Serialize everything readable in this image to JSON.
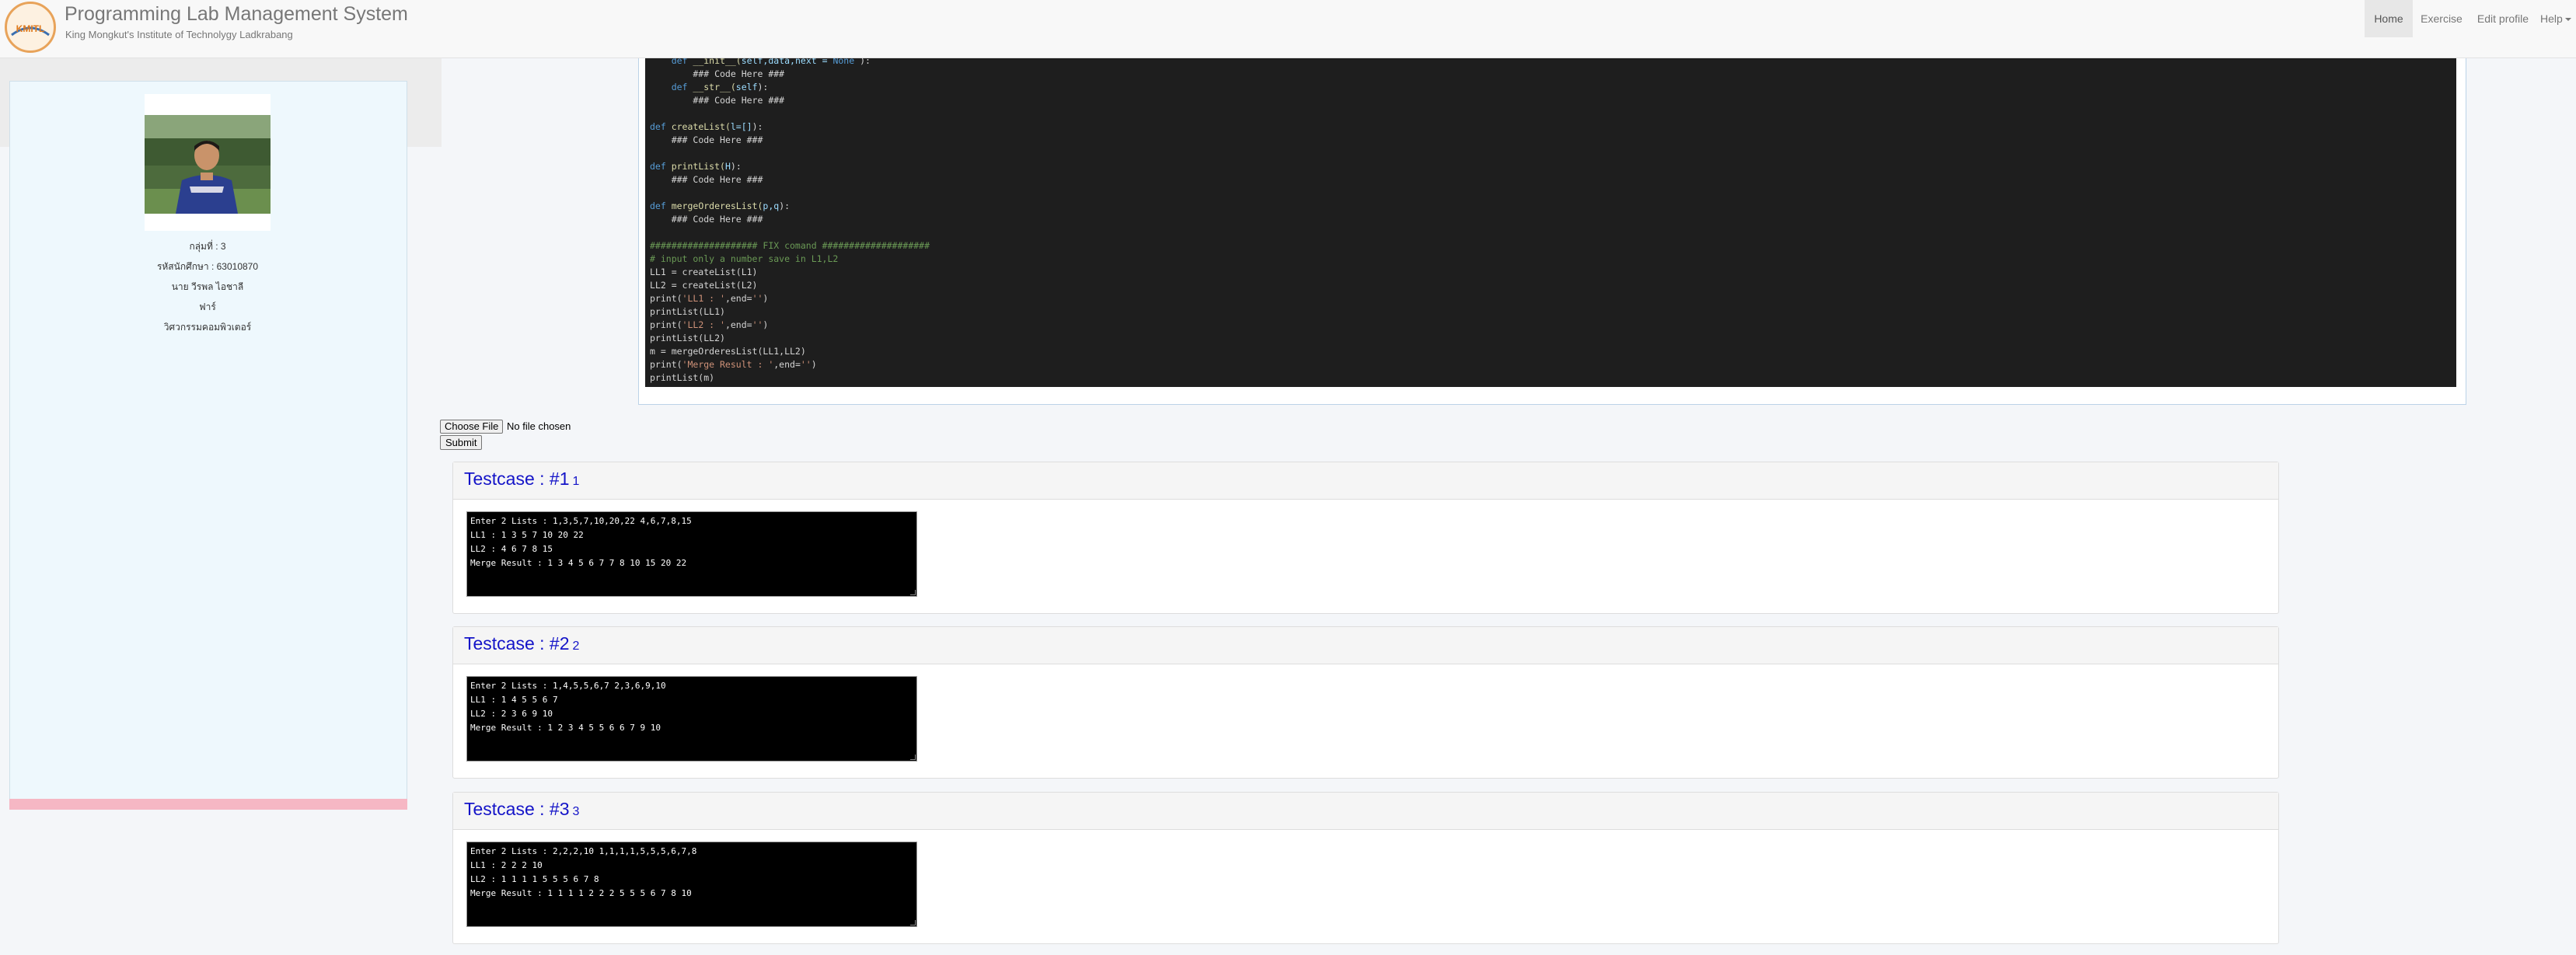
{
  "app": {
    "title": "Programming Lab Management System",
    "subtitle": "King Mongkut's Institute of Technolygy Ladkrabang",
    "logo_text": "KMITL"
  },
  "nav": {
    "home": "Home",
    "exercise": "Exercise",
    "edit_profile": "Edit profile",
    "help": "Help"
  },
  "profile": {
    "group": "กลุ่มที่ : 3",
    "student_id": "รหัสนักศึกษา : 63010870",
    "name": "นาย วีรพล ไอชาลี",
    "nickname": "ฟาร์",
    "faculty": "วิศวกรรมคอมพิวเตอร์"
  },
  "code_lines": [
    {
      "indent": "    ",
      "tokens": [
        {
          "t": "def",
          "c": "kw"
        },
        {
          "t": " __init__(",
          "c": "fn"
        },
        {
          "t": "self,data,next = ",
          "c": "var"
        },
        {
          "t": "None",
          "c": "kw"
        },
        {
          "t": " ):",
          "c": ""
        }
      ]
    },
    {
      "indent": "        ",
      "tokens": [
        {
          "t": "### Code Here ###",
          "c": ""
        }
      ]
    },
    {
      "indent": "    ",
      "tokens": [
        {
          "t": "def",
          "c": "kw"
        },
        {
          "t": " __str__(",
          "c": "fn"
        },
        {
          "t": "self",
          "c": "var"
        },
        {
          "t": "):",
          "c": ""
        }
      ]
    },
    {
      "indent": "        ",
      "tokens": [
        {
          "t": "### Code Here ###",
          "c": ""
        }
      ]
    },
    {
      "indent": "",
      "tokens": []
    },
    {
      "indent": "",
      "tokens": [
        {
          "t": "def",
          "c": "kw"
        },
        {
          "t": " createList(",
          "c": "fn"
        },
        {
          "t": "l=[]",
          "c": "var"
        },
        {
          "t": "):",
          "c": ""
        }
      ]
    },
    {
      "indent": "    ",
      "tokens": [
        {
          "t": "### Code Here ###",
          "c": ""
        }
      ]
    },
    {
      "indent": "",
      "tokens": []
    },
    {
      "indent": "",
      "tokens": [
        {
          "t": "def",
          "c": "kw"
        },
        {
          "t": " printList(",
          "c": "fn"
        },
        {
          "t": "H",
          "c": "var"
        },
        {
          "t": "):",
          "c": ""
        }
      ]
    },
    {
      "indent": "    ",
      "tokens": [
        {
          "t": "### Code Here ###",
          "c": ""
        }
      ]
    },
    {
      "indent": "",
      "tokens": []
    },
    {
      "indent": "",
      "tokens": [
        {
          "t": "def",
          "c": "kw"
        },
        {
          "t": " mergeOrderesList(",
          "c": "fn"
        },
        {
          "t": "p,q",
          "c": "var"
        },
        {
          "t": "):",
          "c": ""
        }
      ]
    },
    {
      "indent": "    ",
      "tokens": [
        {
          "t": "### Code Here ###",
          "c": ""
        }
      ]
    },
    {
      "indent": "",
      "tokens": []
    },
    {
      "indent": "",
      "tokens": [
        {
          "t": "#################### FIX comand ####################",
          "c": "cm"
        }
      ]
    },
    {
      "indent": "",
      "tokens": [
        {
          "t": "# input only a number save in L1,L2",
          "c": "cm"
        }
      ]
    },
    {
      "indent": "",
      "tokens": [
        {
          "t": "LL1 = createList(L1)",
          "c": ""
        }
      ]
    },
    {
      "indent": "",
      "tokens": [
        {
          "t": "LL2 = createList(L2)",
          "c": ""
        }
      ]
    },
    {
      "indent": "",
      "tokens": [
        {
          "t": "print(",
          "c": ""
        },
        {
          "t": "'LL1 : '",
          "c": "str"
        },
        {
          "t": ",end=",
          "c": ""
        },
        {
          "t": "''",
          "c": "str"
        },
        {
          "t": ")",
          "c": ""
        }
      ]
    },
    {
      "indent": "",
      "tokens": [
        {
          "t": "printList(LL1)",
          "c": ""
        }
      ]
    },
    {
      "indent": "",
      "tokens": [
        {
          "t": "print(",
          "c": ""
        },
        {
          "t": "'LL2 : '",
          "c": "str"
        },
        {
          "t": ",end=",
          "c": ""
        },
        {
          "t": "''",
          "c": "str"
        },
        {
          "t": ")",
          "c": ""
        }
      ]
    },
    {
      "indent": "",
      "tokens": [
        {
          "t": "printList(LL2)",
          "c": ""
        }
      ]
    },
    {
      "indent": "",
      "tokens": [
        {
          "t": "m = mergeOrderesList(LL1,LL2)",
          "c": ""
        }
      ]
    },
    {
      "indent": "",
      "tokens": [
        {
          "t": "print(",
          "c": ""
        },
        {
          "t": "'Merge Result : '",
          "c": "str"
        },
        {
          "t": ",end=",
          "c": ""
        },
        {
          "t": "''",
          "c": "str"
        },
        {
          "t": ")",
          "c": ""
        }
      ]
    },
    {
      "indent": "",
      "tokens": [
        {
          "t": "printList(m)",
          "c": ""
        }
      ]
    }
  ],
  "upload": {
    "choose_file": "Choose File",
    "no_file": "No file chosen",
    "submit": "Submit"
  },
  "testcases": [
    {
      "title": "Testcase : #1",
      "number": "1",
      "output": [
        "Enter 2 Lists : 1,3,5,7,10,20,22 4,6,7,8,15",
        "LL1 : 1 3 5 7 10 20 22",
        "LL2 : 4 6 7 8 15",
        "Merge Result : 1 3 4 5 6 7 7 8 10 15 20 22"
      ]
    },
    {
      "title": "Testcase : #2",
      "number": "2",
      "output": [
        "Enter 2 Lists : 1,4,5,5,6,7 2,3,6,9,10",
        "LL1 : 1 4 5 5 6 7",
        "LL2 : 2 3 6 9 10",
        "Merge Result : 1 2 3 4 5 5 6 6 7 9 10"
      ]
    },
    {
      "title": "Testcase : #3",
      "number": "3",
      "output": [
        "Enter 2 Lists : 2,2,2,10 1,1,1,1,5,5,5,6,7,8",
        "LL1 : 2 2 2 10",
        "LL2 : 1 1 1 1 5 5 5 6 7 8",
        "Merge Result : 1 1 1 1 2 2 2 5 5 5 6 7 8 10"
      ]
    }
  ]
}
